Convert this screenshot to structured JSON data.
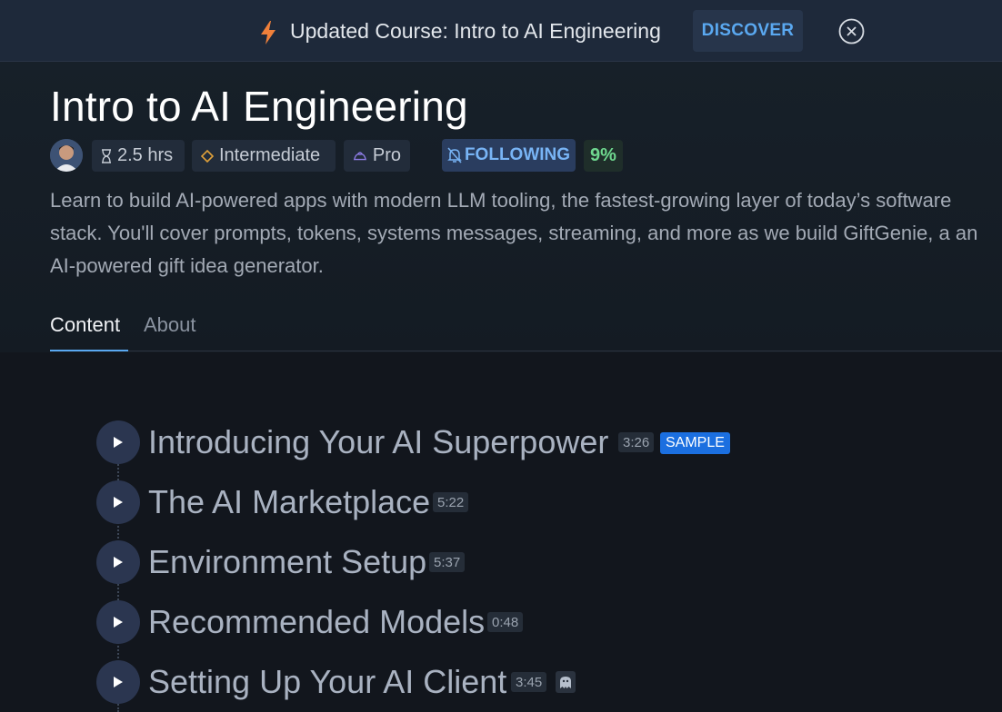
{
  "banner": {
    "icon": "lightning-bolt-icon",
    "message": "Updated Course: Intro to AI Engineering",
    "discover_label": "DISCOVER",
    "close_icon": "close-circle-icon"
  },
  "course": {
    "title": "Intro to AI Engineering",
    "duration": "2.5 hrs",
    "level": "Intermediate",
    "tier": "Pro",
    "following_label": "FOLLOWING",
    "progress": "9%",
    "description": "Learn to build AI-powered apps with modern LLM tooling, the fastest-growing layer of today’s software stack. You'll cover prompts, tokens, systems messages, streaming, and more as we build GiftGenie, a an AI-powered gift idea generator."
  },
  "tabs": {
    "content": "Content",
    "about": "About"
  },
  "lessons": [
    {
      "title": "Introducing Your AI Superpower",
      "duration": "3:26",
      "badge": "SAMPLE"
    },
    {
      "title": "The AI Marketplace",
      "duration": "5:22"
    },
    {
      "title": "Environment Setup",
      "duration": "5:37"
    },
    {
      "title": "Recommended Models",
      "duration": "0:48"
    },
    {
      "title": "Setting Up Your AI Client",
      "duration": "3:45",
      "icon": "ghost-icon"
    }
  ],
  "colors": {
    "accent": "#5aa8f0",
    "sample_badge": "#1b6fe0",
    "progress": "#6fd88f",
    "level_icon": "#e0a13a"
  }
}
